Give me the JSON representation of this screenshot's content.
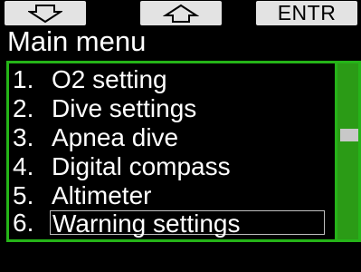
{
  "softkeys": {
    "left": {
      "icon": "arrow-down-outline-icon"
    },
    "center": {
      "icon": "arrow-up-outline-icon"
    },
    "right": {
      "label": "ENTR"
    }
  },
  "header": {
    "title": "Main menu"
  },
  "menu": {
    "selected_index": 5,
    "items": [
      {
        "num": "1.",
        "label": "O2 setting"
      },
      {
        "num": "2.",
        "label": "Dive settings"
      },
      {
        "num": "3.",
        "label": "Apnea dive"
      },
      {
        "num": "4.",
        "label": "Digital compass"
      },
      {
        "num": "5.",
        "label": "Altimeter"
      },
      {
        "num": "6.",
        "label": "Warning settings"
      }
    ]
  },
  "scrollbar": {
    "position_fraction": 0.4
  },
  "colors": {
    "background": "#000000",
    "frame_green": "#25b418",
    "scrollbar_green": "#2b9b16",
    "softkey_bg": "#e3e3e3",
    "text": "#ffffff"
  }
}
